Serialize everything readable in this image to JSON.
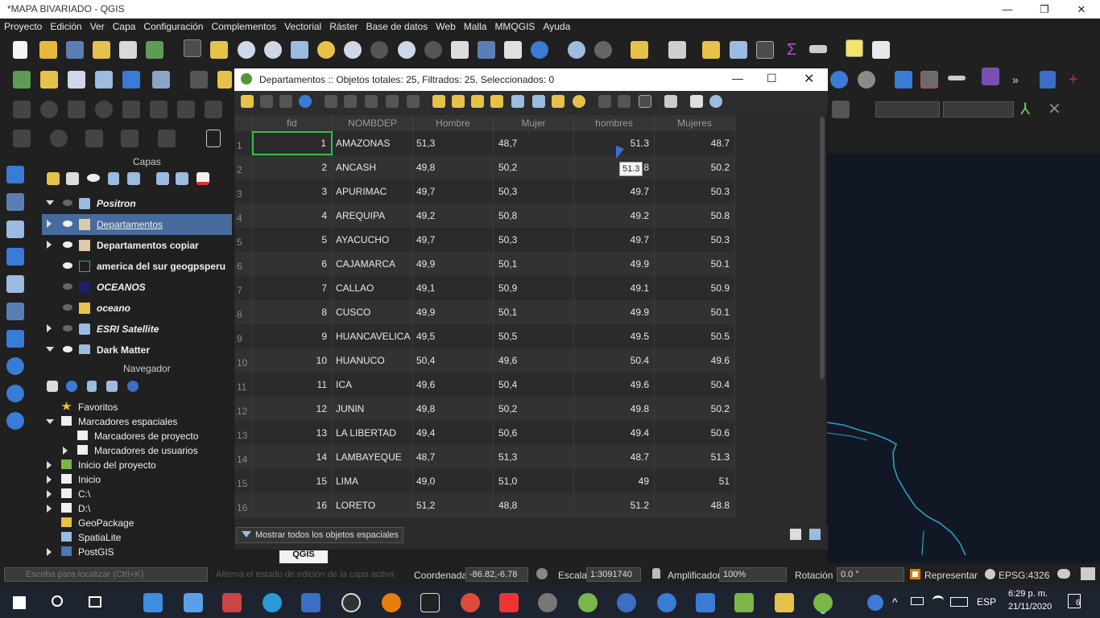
{
  "window": {
    "title": "*MAPA BIVARIADO - QGIS",
    "minimize": "—",
    "maximize": "❐",
    "close": "✕"
  },
  "menu": [
    "Proyecto",
    "Edición",
    "Ver",
    "Capa",
    "Configuración",
    "Complementos",
    "Vectorial",
    "Ráster",
    "Base de datos",
    "Web",
    "Malla",
    "MMQGIS",
    "Ayuda"
  ],
  "panels": {
    "layers_title": "Capas",
    "browser_title": "Navegador"
  },
  "layers": [
    {
      "name": "Positron",
      "visible": false,
      "expanded": true,
      "italic": true,
      "selected": false,
      "icon": "tile-icon"
    },
    {
      "name": "Departamentos",
      "visible": true,
      "expanded": false,
      "italic": false,
      "selected": true,
      "icon": "polygon-icon"
    },
    {
      "name": "Departamentos copiar",
      "visible": true,
      "expanded": false,
      "italic": false,
      "selected": false,
      "icon": "polygon-icon"
    },
    {
      "name": "america del sur geogpsperu",
      "visible": true,
      "expanded": null,
      "italic": false,
      "selected": false,
      "icon": "square-outline-icon"
    },
    {
      "name": "OCEANOS",
      "visible": false,
      "expanded": null,
      "italic": true,
      "selected": false,
      "icon": "square-navy-icon"
    },
    {
      "name": "oceano",
      "visible": false,
      "expanded": null,
      "italic": true,
      "selected": false,
      "icon": "square-yellow-icon"
    },
    {
      "name": "ESRI Satellite",
      "visible": false,
      "expanded": false,
      "italic": true,
      "selected": false,
      "icon": "tile-icon"
    },
    {
      "name": "Dark Matter",
      "visible": true,
      "expanded": true,
      "italic": false,
      "selected": false,
      "icon": "tile-icon"
    }
  ],
  "browser": [
    {
      "label": "Favoritos",
      "indent": 0,
      "arrow": "none",
      "icon": "star-icon"
    },
    {
      "label": "Marcadores espaciales",
      "indent": 0,
      "arrow": "down",
      "icon": "folder-icon"
    },
    {
      "label": "Marcadores de proyecto",
      "indent": 1,
      "arrow": "none",
      "icon": "folder-icon"
    },
    {
      "label": "Marcadores de usuarios",
      "indent": 1,
      "arrow": "right",
      "icon": "folder-icon"
    },
    {
      "label": "Inicio del proyecto",
      "indent": 0,
      "arrow": "right",
      "icon": "project-home-icon"
    },
    {
      "label": "Inicio",
      "indent": 0,
      "arrow": "right",
      "icon": "folder-icon"
    },
    {
      "label": "C:\\",
      "indent": 0,
      "arrow": "right",
      "icon": "folder-icon"
    },
    {
      "label": "D:\\",
      "indent": 0,
      "arrow": "right",
      "icon": "folder-icon"
    },
    {
      "label": "GeoPackage",
      "indent": 0,
      "arrow": "none",
      "icon": "geopackage-icon"
    },
    {
      "label": "SpatiaLite",
      "indent": 0,
      "arrow": "none",
      "icon": "spatialite-icon"
    },
    {
      "label": "PostGIS",
      "indent": 0,
      "arrow": "right",
      "icon": "postgis-icon"
    }
  ],
  "attr_table": {
    "title": "Departamentos :: Objetos totales: 25, Filtrados: 25, Seleccionados: 0",
    "columns": [
      "fid",
      "NOMBDEP",
      "Hombre",
      "Mujer",
      "hombres",
      "Mujeres"
    ],
    "rows": [
      [
        "1",
        "1",
        "AMAZONAS",
        "51,3",
        "48,7",
        "51.3",
        "48.7"
      ],
      [
        "2",
        "2",
        "ANCASH",
        "49,8",
        "50,2",
        "49.8",
        "50.2"
      ],
      [
        "3",
        "3",
        "APURIMAC",
        "49,7",
        "50,3",
        "49.7",
        "50.3"
      ],
      [
        "4",
        "4",
        "AREQUIPA",
        "49,2",
        "50,8",
        "49.2",
        "50.8"
      ],
      [
        "5",
        "5",
        "AYACUCHO",
        "49,7",
        "50,3",
        "49.7",
        "50.3"
      ],
      [
        "6",
        "6",
        "CAJAMARCA",
        "49,9",
        "50,1",
        "49.9",
        "50.1"
      ],
      [
        "7",
        "7",
        "CALLAO",
        "49,1",
        "50,9",
        "49.1",
        "50.9"
      ],
      [
        "8",
        "8",
        "CUSCO",
        "49,9",
        "50,1",
        "49.9",
        "50.1"
      ],
      [
        "9",
        "9",
        "HUANCAVELICA",
        "49,5",
        "50,5",
        "49.5",
        "50.5"
      ],
      [
        "10",
        "10",
        "HUANUCO",
        "50,4",
        "49,6",
        "50.4",
        "49.6"
      ],
      [
        "11",
        "11",
        "ICA",
        "49,6",
        "50,4",
        "49.6",
        "50.4"
      ],
      [
        "12",
        "12",
        "JUNIN",
        "49,8",
        "50,2",
        "49.8",
        "50.2"
      ],
      [
        "13",
        "13",
        "LA LIBERTAD",
        "49,4",
        "50,6",
        "49.4",
        "50.6"
      ],
      [
        "14",
        "14",
        "LAMBAYEQUE",
        "48,7",
        "51,3",
        "48.7",
        "51.3"
      ],
      [
        "15",
        "15",
        "LIMA",
        "49,0",
        "51,0",
        "49",
        "51"
      ],
      [
        "16",
        "16",
        "LORETO",
        "51,2",
        "48,8",
        "51.2",
        "48.8"
      ]
    ],
    "tooltip": "51.3",
    "filter_button": "Mostrar todos los objetos espaciales"
  },
  "status": {
    "locate_placeholder": "Escriba para localizar (Ctrl+K)",
    "hint": "Alterna el estado de edición de la capa activa",
    "coord_label": "Coordenada",
    "coord_value": "-86.82,-6.78",
    "scale_label": "Escala",
    "scale_value": "1:3091740",
    "magnifier_label": "Amplificador",
    "magnifier_value": "100%",
    "rotation_label": "Rotación",
    "rotation_value": "0.0 °",
    "render_label": "Representar",
    "crs": "EPSG:4326"
  },
  "taskbar": {
    "lang": "ESP",
    "time": "6:29 p. m.",
    "date": "21/11/2020",
    "notifications": "6"
  },
  "map_credit": "QGIS",
  "colors": {
    "accent": "#466b9c",
    "selection": "#2fc04a",
    "map_bg": "#121726",
    "boundary": "#2aa0c0"
  }
}
